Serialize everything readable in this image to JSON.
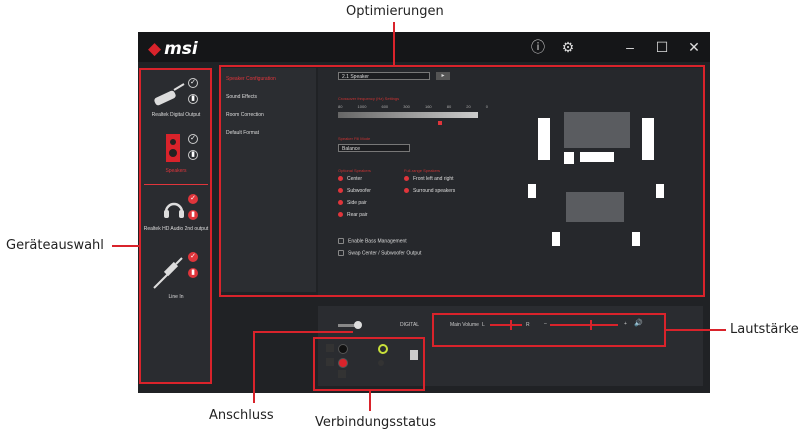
{
  "callouts": {
    "top": "Optimierungen",
    "left": "Geräteauswahl",
    "right": "Lautstärke",
    "bottom_left": "Anschluss",
    "bottom_center": "Verbindungsstatus"
  },
  "app": {
    "logo": "msi",
    "titlebar_icons": [
      "info-icon",
      "settings-icon",
      "minimize-icon",
      "maximize-icon",
      "close-icon"
    ],
    "titlebar_glyphs": {
      "info": "ⓘ",
      "settings": "⚙",
      "minimize": "–",
      "maximize": "☐",
      "close": "✕"
    }
  },
  "devices": [
    {
      "label": "Realtek Digital Output",
      "active": false
    },
    {
      "label": "Speakers",
      "active": true
    },
    {
      "label": "Realtek HD Audio 2nd output",
      "active": false
    },
    {
      "label": "Line In",
      "active": false
    }
  ],
  "menu": {
    "items": [
      "Speaker Configuration",
      "Sound Effects",
      "Room Correction",
      "Default Format"
    ]
  },
  "content": {
    "speaker_select": "2.1 Speaker",
    "section_crossover": "Crossover frequency (Hz) Settings",
    "freq_ticks": [
      "80",
      "1000",
      "600",
      "300",
      "160",
      "80",
      "20",
      "0"
    ],
    "section_balance": "Speaker Fill Mode",
    "balance_select": "Balance",
    "section_optional": "Optional Speakers",
    "section_fullrange": "Full-range Speakers",
    "optional_items": [
      "Center",
      "Subwoofer",
      "Side pair",
      "Rear pair"
    ],
    "fullrange_items": [
      "Front left and right",
      "Surround speakers"
    ],
    "options": [
      "Enable Bass Management",
      "Swap Center / Subwoofer Output"
    ]
  },
  "bottom": {
    "digital": "DIGITAL",
    "volume_label": "Main Volume",
    "vol_left": "L",
    "vol_r": "R",
    "vol_plus": "+",
    "vol_minus": "–",
    "mute_icon": "🔊"
  },
  "colors": {
    "accent": "#d9232b",
    "app_bg": "#202225"
  }
}
